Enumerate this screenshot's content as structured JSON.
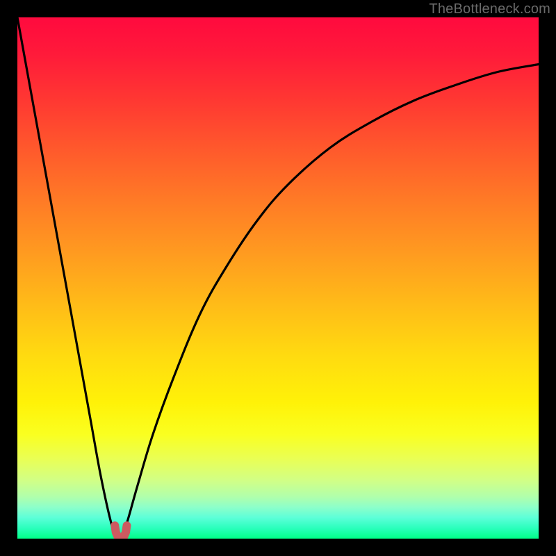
{
  "watermark": "TheBottleneck.com",
  "colors": {
    "background": "#000000",
    "curve": "#000000",
    "marker": "#cc5a60",
    "gradient_top": "#ff0a3e",
    "gradient_bottom": "#00ff88"
  },
  "chart_data": {
    "type": "line",
    "title": "",
    "xlabel": "",
    "ylabel": "",
    "xlim": [
      0,
      100
    ],
    "ylim": [
      0,
      100
    ],
    "grid": false,
    "legend": false,
    "note": "Bottleneck-style curve: y-axis inverted visually (0 at bottom = best / green, 100 at top = worst / red). Minimum near x≈19.5.",
    "series": [
      {
        "name": "bottleneck-curve",
        "x": [
          0,
          2,
          4,
          6,
          8,
          10,
          12,
          14,
          16,
          18,
          19,
          19.5,
          20,
          21,
          23,
          26,
          30,
          35,
          40,
          46,
          52,
          60,
          68,
          76,
          84,
          92,
          100
        ],
        "y": [
          100,
          89,
          78,
          67,
          56,
          45,
          34,
          23,
          12,
          3,
          0.8,
          0,
          0.8,
          3,
          10,
          20,
          31,
          43,
          52,
          61,
          68,
          75,
          80,
          84,
          87,
          89.5,
          91
        ]
      }
    ],
    "markers": {
      "name": "optimal-marker",
      "shape": "u",
      "color": "#cc5a60",
      "points_x": [
        18.7,
        18.9,
        19.3,
        19.9,
        20.4,
        20.8,
        21.0
      ],
      "points_y": [
        2.5,
        1.2,
        0.3,
        0.0,
        0.3,
        1.2,
        2.5
      ]
    }
  }
}
